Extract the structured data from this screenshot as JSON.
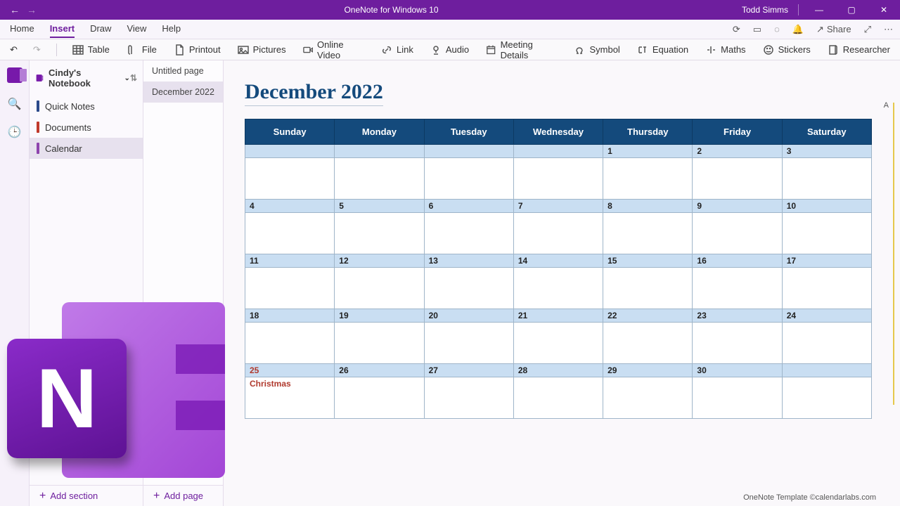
{
  "titlebar": {
    "app": "OneNote for Windows 10",
    "user": "Todd Simms"
  },
  "menu": {
    "tabs": [
      "Home",
      "Insert",
      "Draw",
      "View",
      "Help"
    ],
    "active": "Insert",
    "share": "Share"
  },
  "ribbon": [
    {
      "k": "table",
      "label": "Table"
    },
    {
      "k": "file",
      "label": "File"
    },
    {
      "k": "printout",
      "label": "Printout"
    },
    {
      "k": "pictures",
      "label": "Pictures"
    },
    {
      "k": "video",
      "label": "Online Video"
    },
    {
      "k": "link",
      "label": "Link"
    },
    {
      "k": "audio",
      "label": "Audio"
    },
    {
      "k": "meeting",
      "label": "Meeting Details"
    },
    {
      "k": "symbol",
      "label": "Symbol"
    },
    {
      "k": "equation",
      "label": "Equation"
    },
    {
      "k": "maths",
      "label": "Maths"
    },
    {
      "k": "stickers",
      "label": "Stickers"
    },
    {
      "k": "researcher",
      "label": "Researcher"
    }
  ],
  "notebook": {
    "name": "Cindy's Notebook"
  },
  "sections": [
    {
      "label": "Quick Notes",
      "color": "#2b4a8b"
    },
    {
      "label": "Documents",
      "color": "#c0392b"
    },
    {
      "label": "Calendar",
      "color": "#8e44ad",
      "active": true
    }
  ],
  "pages": [
    {
      "label": "Untitled page"
    },
    {
      "label": "December 2022",
      "active": true
    }
  ],
  "add": {
    "section": "Add section",
    "page": "Add page"
  },
  "calendar": {
    "title": "December 2022",
    "days": [
      "Sunday",
      "Monday",
      "Tuesday",
      "Wednesday",
      "Thursday",
      "Friday",
      "Saturday"
    ],
    "weeks": [
      [
        null,
        null,
        null,
        null,
        "1",
        "2",
        "3"
      ],
      [
        "4",
        "5",
        "6",
        "7",
        "8",
        "9",
        "10"
      ],
      [
        "11",
        "12",
        "13",
        "14",
        "15",
        "16",
        "17"
      ],
      [
        "18",
        "19",
        "20",
        "21",
        "22",
        "23",
        "24"
      ],
      [
        "25",
        "26",
        "27",
        "28",
        "29",
        "30",
        null
      ]
    ],
    "holiday": {
      "date": "25",
      "label": "Christmas"
    },
    "footer": "OneNote Template ©calendarlabs.com",
    "marker": "A"
  }
}
